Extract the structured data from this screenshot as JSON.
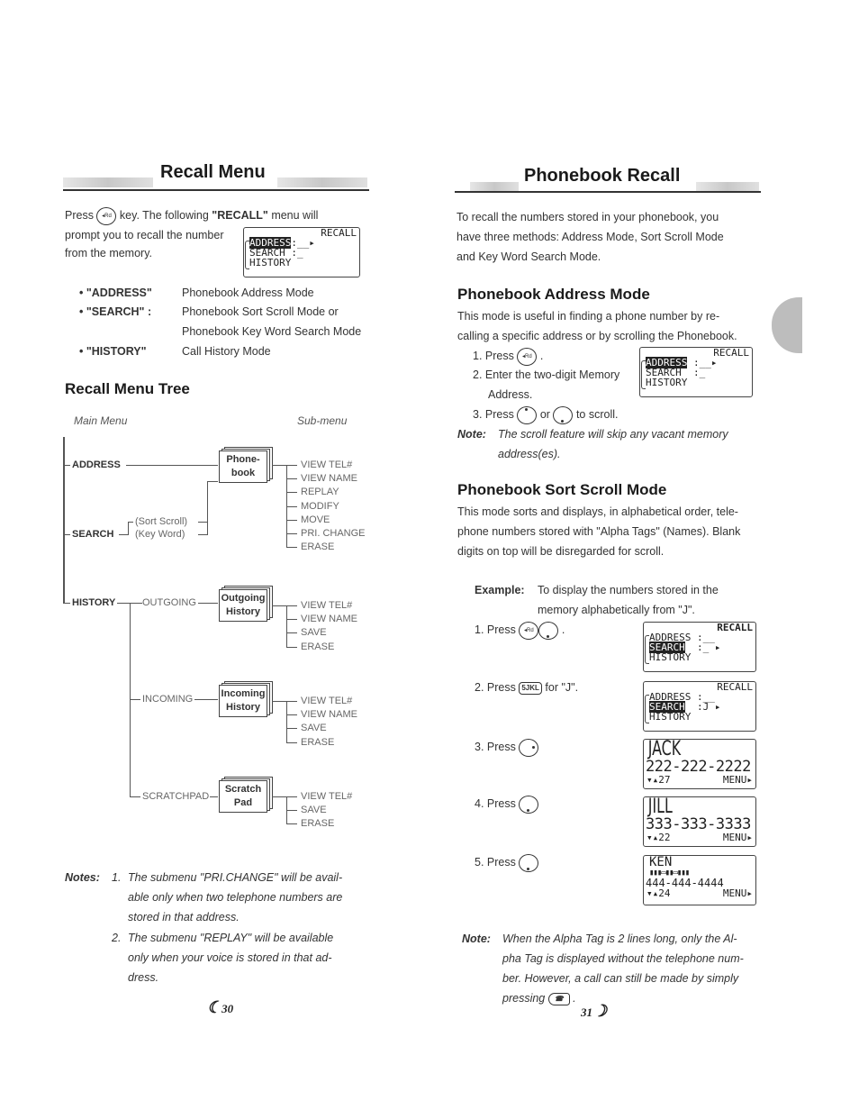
{
  "left_page": {
    "title": "Recall Menu",
    "intro_press": "Press",
    "intro_key": "◂Rd",
    "intro_rest_a": "key. The following ",
    "intro_bold": "\"RECALL\"",
    "intro_rest_b": " menu will",
    "intro_line2": "prompt you to recall the number",
    "intro_line3": "from the memory.",
    "lcd": {
      "title": "RECALL",
      "rows": [
        {
          "label": "ADDRESS",
          "value": ":__▸",
          "highlight": true
        },
        {
          "label": "SEARCH",
          "value": " :_",
          "highlight": false
        },
        {
          "label": "HISTORY",
          "value": "",
          "highlight": false
        }
      ]
    },
    "menu_items": [
      {
        "key": "• \"ADDRESS\"",
        "desc": "Phonebook Address Mode"
      },
      {
        "key": "• \"SEARCH\" :",
        "desc": "Phonebook Sort Scroll Mode or"
      },
      {
        "key": "",
        "desc": "Phonebook Key Word Search Mode"
      },
      {
        "key": "• \"HISTORY\"",
        "desc": "Call History Mode"
      }
    ],
    "tree_title": "Recall Menu Tree",
    "tree": {
      "main_header": "Main Menu",
      "sub_header": "Sub-menu",
      "main": [
        "ADDRESS",
        "SEARCH",
        "HISTORY"
      ],
      "search_modes": [
        "(Sort Scroll)",
        "(Key Word)"
      ],
      "history_branches": [
        "OUTGOING",
        "INCOMING",
        "SCRATCHPAD"
      ],
      "boxes": [
        {
          "line1": "Phone-",
          "line2": "book",
          "items": [
            "VIEW TEL#",
            "VIEW NAME",
            "REPLAY",
            "MODIFY",
            "MOVE",
            "PRI. CHANGE",
            "ERASE"
          ]
        },
        {
          "line1": "Outgoing",
          "line2": "History",
          "items": [
            "VIEW TEL#",
            "VIEW NAME",
            "SAVE",
            "ERASE"
          ]
        },
        {
          "line1": "Incoming",
          "line2": "History",
          "items": [
            "VIEW TEL#",
            "VIEW NAME",
            "SAVE",
            "ERASE"
          ]
        },
        {
          "line1": "Scratch",
          "line2": "Pad",
          "items": [
            "VIEW TEL#",
            "SAVE",
            "ERASE"
          ]
        }
      ]
    },
    "notes_label": "Notes:",
    "notes": [
      {
        "num": "1.",
        "lines": [
          "The submenu \"PRI.CHANGE\" will be avail-",
          "able only when two telephone numbers are",
          "stored in that address."
        ]
      },
      {
        "num": "2.",
        "lines": [
          "The submenu \"REPLAY\" will be available",
          "only when your voice is stored in that ad-",
          "dress."
        ]
      }
    ],
    "page_number": "30"
  },
  "right_page": {
    "title": "Phonebook Recall",
    "intro": [
      "To recall the numbers stored in your phonebook, you",
      "have three methods: Address Mode, Sort Scroll Mode",
      "and Key Word Search Mode."
    ],
    "address_mode": {
      "heading": "Phonebook Address Mode",
      "desc": [
        "This mode is useful in finding a phone number by re-",
        "calling a specific address or by scrolling the Phonebook."
      ],
      "steps": [
        {
          "num": "1.",
          "text": "Press",
          "after": "."
        },
        {
          "num": "2.",
          "text": "Enter the two-digit Memory"
        },
        {
          "num": "",
          "text": "Address."
        },
        {
          "num": "3.",
          "text": "Press",
          "mid": "or",
          "after": "to scroll."
        }
      ],
      "lcd": {
        "title": "RECALL",
        "rows": [
          {
            "label": "ADDRESS",
            "value": " :__▸",
            "highlight": true
          },
          {
            "label": "SEARCH",
            "value": "  :_",
            "highlight": false
          },
          {
            "label": "HISTORY",
            "value": "",
            "highlight": false
          }
        ]
      },
      "note_label": "Note:",
      "note": [
        "The scroll feature will skip any vacant memory",
        "address(es)."
      ]
    },
    "sort_mode": {
      "heading": "Phonebook Sort Scroll Mode",
      "desc": [
        "This mode sorts and displays, in alphabetical order, tele-",
        "phone numbers stored with \"Alpha Tags\" (Names). Blank",
        "digits on top will be disregarded for scroll."
      ],
      "example_label": "Example:",
      "example": [
        "To display the numbers stored in the",
        "memory alphabetically from \"J\"."
      ],
      "steps": [
        {
          "num": "1.",
          "text": "Press",
          "after": "."
        },
        {
          "num": "2.",
          "text": "Press",
          "key": "5JKL",
          "after": "for \"J\"."
        },
        {
          "num": "3.",
          "text": "Press"
        },
        {
          "num": "4.",
          "text": "Press"
        },
        {
          "num": "5.",
          "text": "Press"
        }
      ],
      "lcd1": {
        "title": "RECALL",
        "rows": [
          {
            "label": "ADDRESS",
            "value": " :__",
            "highlight": false
          },
          {
            "label": "SEARCH",
            "value": "  :_ ▸",
            "highlight": true
          },
          {
            "label": "HISTORY",
            "value": "",
            "highlight": false
          }
        ]
      },
      "lcd2": {
        "title": "RECALL",
        "rows": [
          {
            "label": "ADDRESS",
            "value": " :__",
            "highlight": false
          },
          {
            "label": "SEARCH",
            "value": "  :J ▸",
            "highlight": true
          },
          {
            "label": "HISTORY",
            "value": "",
            "highlight": false
          }
        ]
      },
      "entries": [
        {
          "name": "JACK",
          "number": "222-222-2222",
          "index": "▾▴27",
          "menu": "MENU▸"
        },
        {
          "name": "JILL",
          "number": "333-333-3333",
          "index": "▾▴22",
          "menu": "MENU▸"
        },
        {
          "name": "KEN",
          "tag2": "▮▮▮▭▮▮▭▮▮▮",
          "number": "444-444-4444",
          "index": "▾▴24",
          "menu": "MENU▸"
        }
      ]
    },
    "note_label": "Note:",
    "note": [
      "When the Alpha Tag is 2 lines long, only the Al-",
      "pha Tag is displayed without the telephone num-",
      "ber. However, a call can still be made by simply",
      "pressing"
    ],
    "page_number": "31"
  }
}
